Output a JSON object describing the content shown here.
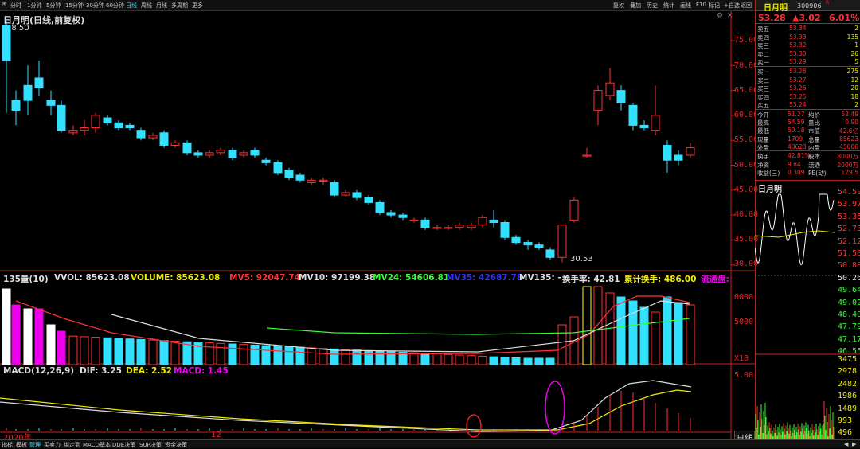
{
  "toolbar": {
    "items": [
      "分时",
      "1分钟",
      "5分钟",
      "15分钟",
      "30分钟",
      "60分钟",
      "日线",
      "周线",
      "月线",
      "多周期",
      "更多"
    ],
    "active": "日线",
    "right": [
      "复权",
      "叠加",
      "历史",
      "统计",
      "画线",
      "F10",
      "标记",
      "+自选",
      "返回"
    ]
  },
  "chart": {
    "title": "日月明(日线,前复权)",
    "high_label": "78.50",
    "low_label": "30.53",
    "year_label": "2020年",
    "month_label": "12",
    "price_axis": [
      "75.00",
      "70.00",
      "65.00",
      "60.00",
      "55.00",
      "50.00",
      "45.00",
      "40.00",
      "35.00",
      "30.00"
    ]
  },
  "volume": {
    "label": "135量(10)",
    "vvol": "VVOL: 85623.08",
    "volume": "VOLUME: 85623.08",
    "mv5": "MV5: 92047.74",
    "mv10": "MV10: 97199.38",
    "mv24": "MV24: 54606.81",
    "mv35": "MV35: 42687.78",
    "mv135": "MV135: -",
    "turnover": "换手率: 42.81",
    "cum_turnover": "累计换手: 486.00",
    "float": "流通盘:",
    "axis": [
      "0000",
      "5000",
      "X10"
    ]
  },
  "macd": {
    "label": "MACD(12,26,9)",
    "dif": "DIF: 3.25",
    "dea": "DEA: 2.52",
    "macd": "MACD: 1.45",
    "axis": [
      "5.00"
    ]
  },
  "quote": {
    "name": "日月明",
    "code": "300906",
    "flag": "R",
    "price": "53.28",
    "change": "▲3.02",
    "pct": "6.01%",
    "asks": [
      {
        "label": "卖五",
        "price": "53.34",
        "vol": "2"
      },
      {
        "label": "卖四",
        "price": "53.33",
        "vol": "135"
      },
      {
        "label": "卖三",
        "price": "53.32",
        "vol": "1"
      },
      {
        "label": "卖二",
        "price": "53.30",
        "vol": "26"
      },
      {
        "label": "卖一",
        "price": "53.29",
        "vol": "5"
      }
    ],
    "bids": [
      {
        "label": "买一",
        "price": "53.28",
        "vol": "275"
      },
      {
        "label": "买二",
        "price": "53.27",
        "vol": "12"
      },
      {
        "label": "买三",
        "price": "53.26",
        "vol": "20"
      },
      {
        "label": "买四",
        "price": "53.25",
        "vol": "18"
      },
      {
        "label": "买五",
        "price": "53.24",
        "vol": "2"
      }
    ],
    "stats": [
      {
        "l1": "今开",
        "v1": "51.27",
        "l2": "均价",
        "v2": "52.49"
      },
      {
        "l1": "最高",
        "v1": "54.59",
        "l2": "量比",
        "v2": "0.90"
      },
      {
        "l1": "最低",
        "v1": "50.18",
        "l2": "市值",
        "v2": "42.6亿"
      },
      {
        "l1": "现量",
        "v1": "1709",
        "l2": "总量",
        "v2": "85623"
      },
      {
        "l1": "外盘",
        "v1": "40623",
        "l2": "内盘",
        "v2": "45000"
      }
    ],
    "stats2": [
      {
        "l1": "换手",
        "v1": "42.81%",
        "l2": "股本",
        "v2": "8000万"
      },
      {
        "l1": "净资",
        "v1": "9.84",
        "l2": "流通",
        "v2": "2000万"
      },
      {
        "l1": "收益(三)",
        "v1": "0.309",
        "l2": "PE(动)",
        "v2": "129.5"
      }
    ]
  },
  "intraday": {
    "name": "日月明",
    "price_labels": [
      "54.59",
      "53.97",
      "53.35",
      "52.73",
      "52.12",
      "51.50",
      "50.88",
      "50.26",
      "49.64",
      "49.02",
      "48.40",
      "47.79",
      "47.17",
      "46.55"
    ],
    "vol_labels": [
      "3475",
      "2978",
      "2482",
      "1986",
      "1489",
      "993",
      "496"
    ],
    "tab": "日线"
  },
  "bottom": [
    "指标",
    "模板",
    "管理",
    "买卖力",
    "绑定到",
    "MACD基本",
    "DDE决策",
    "SUP决策",
    "资金决策"
  ],
  "colors": {
    "up": "#ff3333",
    "down": "#33e0ff",
    "axis": "#cc2020"
  },
  "icons": [
    "chevron-left-icon",
    "chevron-right-icon",
    "settings-icon"
  ]
}
